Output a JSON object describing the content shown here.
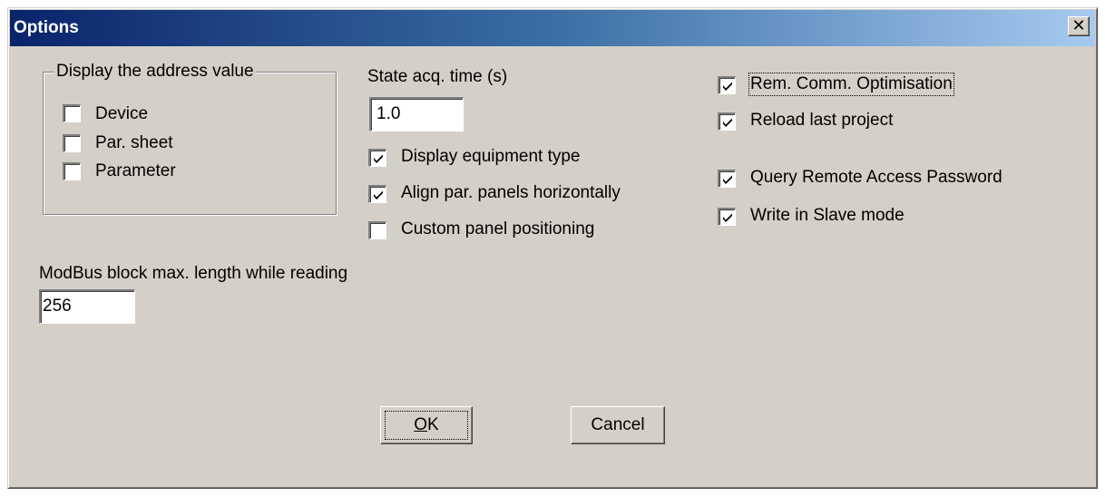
{
  "window": {
    "title": "Options",
    "close_glyph": "✕"
  },
  "display_address": {
    "legend": "Display the address value",
    "items": [
      {
        "label": "Device",
        "checked": false
      },
      {
        "label": "Par. sheet",
        "checked": false
      },
      {
        "label": "Parameter",
        "checked": false
      }
    ]
  },
  "state_acq": {
    "label": "State acq. time (s)",
    "value": "1.0"
  },
  "middle_options": [
    {
      "label": "Display equipment type",
      "checked": true
    },
    {
      "label": "Align par. panels horizontally",
      "checked": true
    },
    {
      "label": "Custom panel positioning",
      "checked": false
    }
  ],
  "right_options": [
    {
      "label": "Rem. Comm. Optimisation",
      "checked": true
    },
    {
      "label": "Reload last project",
      "checked": true
    },
    {
      "label": "Query Remote Access Password",
      "checked": true
    },
    {
      "label": "Write in Slave mode",
      "checked": true
    }
  ],
  "modbus": {
    "label": "ModBus block max. length while reading",
    "value": "256"
  },
  "buttons": {
    "ok_accel": "O",
    "ok_rest": "K",
    "cancel": "Cancel"
  },
  "colors": {
    "face": "#d4d0c8",
    "title_start": "#0a246a",
    "title_end": "#a6caf0"
  },
  "icons": {
    "close": "close-icon",
    "check": "checkmark-icon"
  }
}
